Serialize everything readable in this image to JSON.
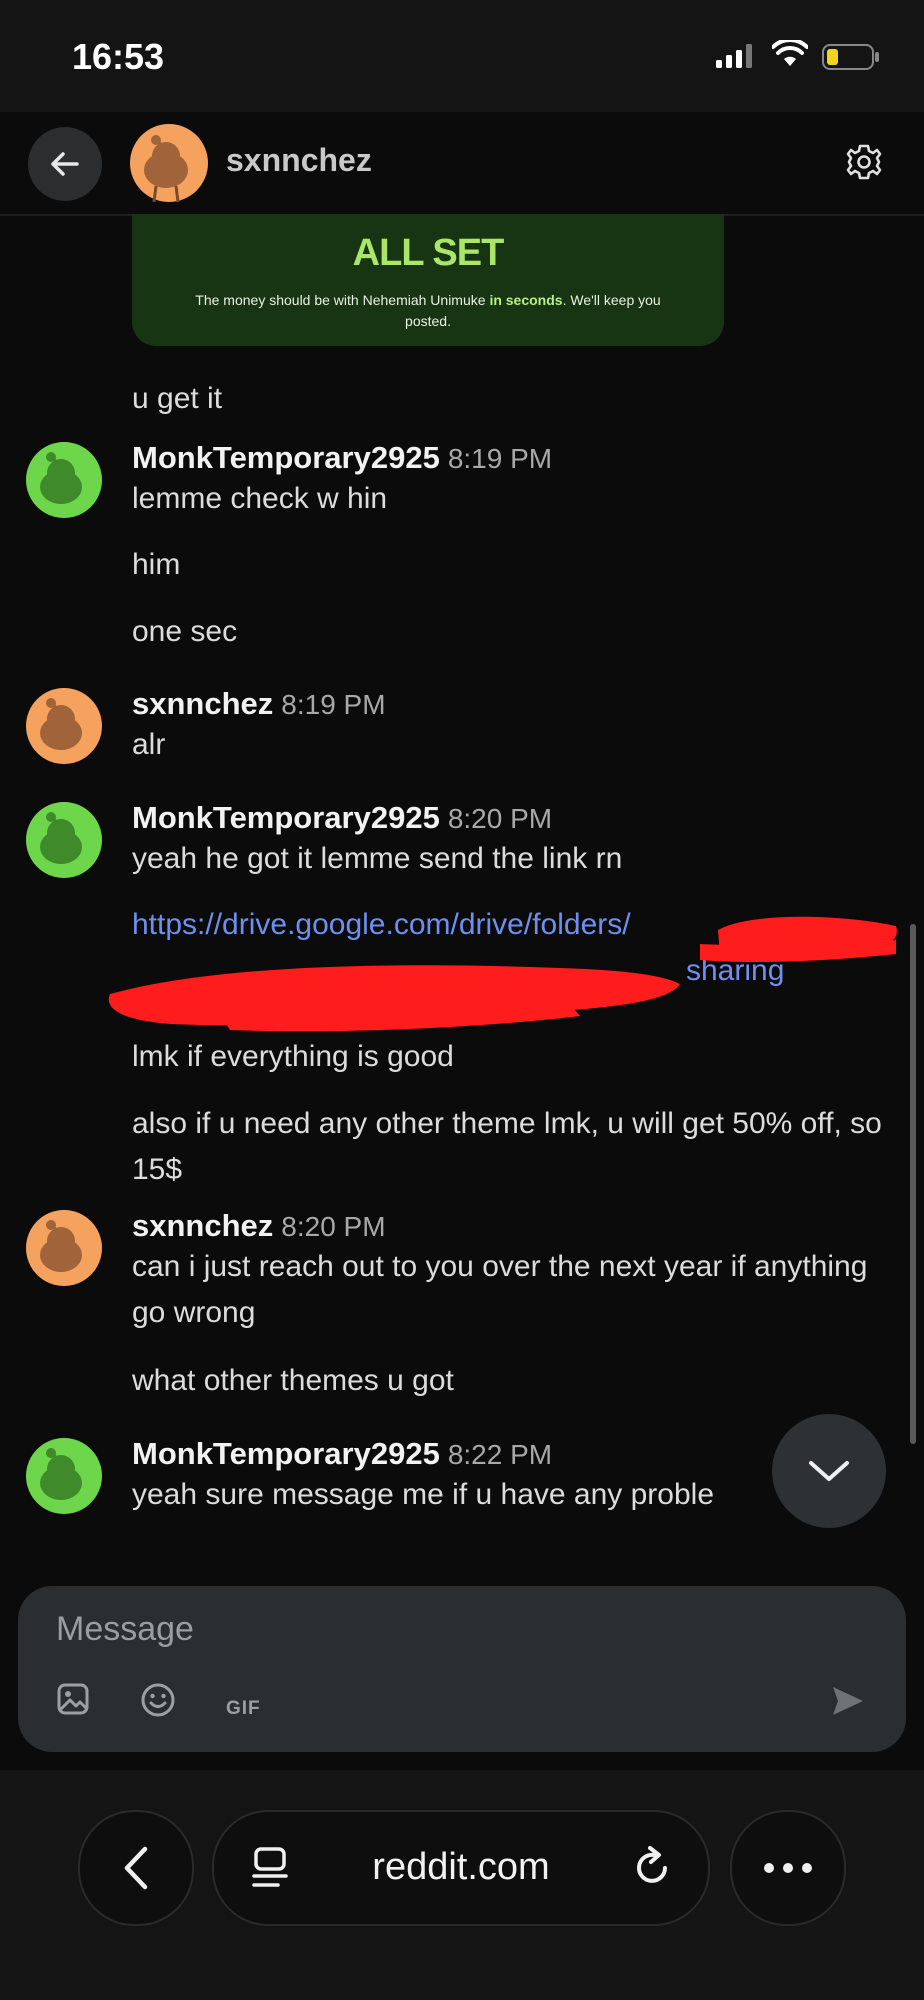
{
  "status_bar": {
    "time": "16:53"
  },
  "header": {
    "contact_name": "sxnnchez"
  },
  "payment_card": {
    "title": "ALL SET",
    "text_before": "The money should be with Nehemiah Unimuke ",
    "text_bold": "in seconds",
    "text_after": ". We'll keep you posted."
  },
  "messages": [
    {
      "type": "text",
      "text": "u get it"
    },
    {
      "type": "sender",
      "name": "MonkTemporary2925",
      "time": "8:19 PM",
      "avatar": "green"
    },
    {
      "type": "text",
      "text": "lemme check w hin"
    },
    {
      "type": "text",
      "text": "him"
    },
    {
      "type": "text",
      "text": "one sec"
    },
    {
      "type": "sender",
      "name": "sxnnchez",
      "time": "8:19 PM",
      "avatar": "orange"
    },
    {
      "type": "text",
      "text": "alr"
    },
    {
      "type": "sender",
      "name": "MonkTemporary2925",
      "time": "8:20 PM",
      "avatar": "green"
    },
    {
      "type": "text",
      "text": "yeah he got it lemme send the link rn"
    },
    {
      "type": "link",
      "line1": "https://drive.google.com/drive/folders/",
      "line2": "sharing"
    },
    {
      "type": "text",
      "text": "lmk if everything is good"
    },
    {
      "type": "text",
      "text": "also if u need any other theme lmk, u will get 50% off, so 15$"
    },
    {
      "type": "sender",
      "name": "sxnnchez",
      "time": "8:20 PM",
      "avatar": "orange"
    },
    {
      "type": "text",
      "text": "can i just reach out to you over the next year if anything go wrong"
    },
    {
      "type": "text",
      "text": "what other themes u got"
    },
    {
      "type": "sender",
      "name": "MonkTemporary2925",
      "time": "8:22 PM",
      "avatar": "green"
    },
    {
      "type": "text",
      "text": "yeah sure message me if u have any proble"
    }
  ],
  "composer": {
    "placeholder": "Message",
    "gif_label": "GIF"
  },
  "browser": {
    "url": "reddit.com"
  },
  "colors": {
    "green_avatar": "#6ed64a",
    "orange_avatar": "#f5a25f",
    "link": "#6f8ff0",
    "card_bg": "#173513"
  },
  "icons": [
    "back-arrow-icon",
    "gear-icon",
    "image-icon",
    "emoji-icon",
    "send-icon",
    "chevron-down-icon",
    "chevron-left-icon",
    "tabs-icon",
    "reload-icon",
    "more-icon"
  ]
}
